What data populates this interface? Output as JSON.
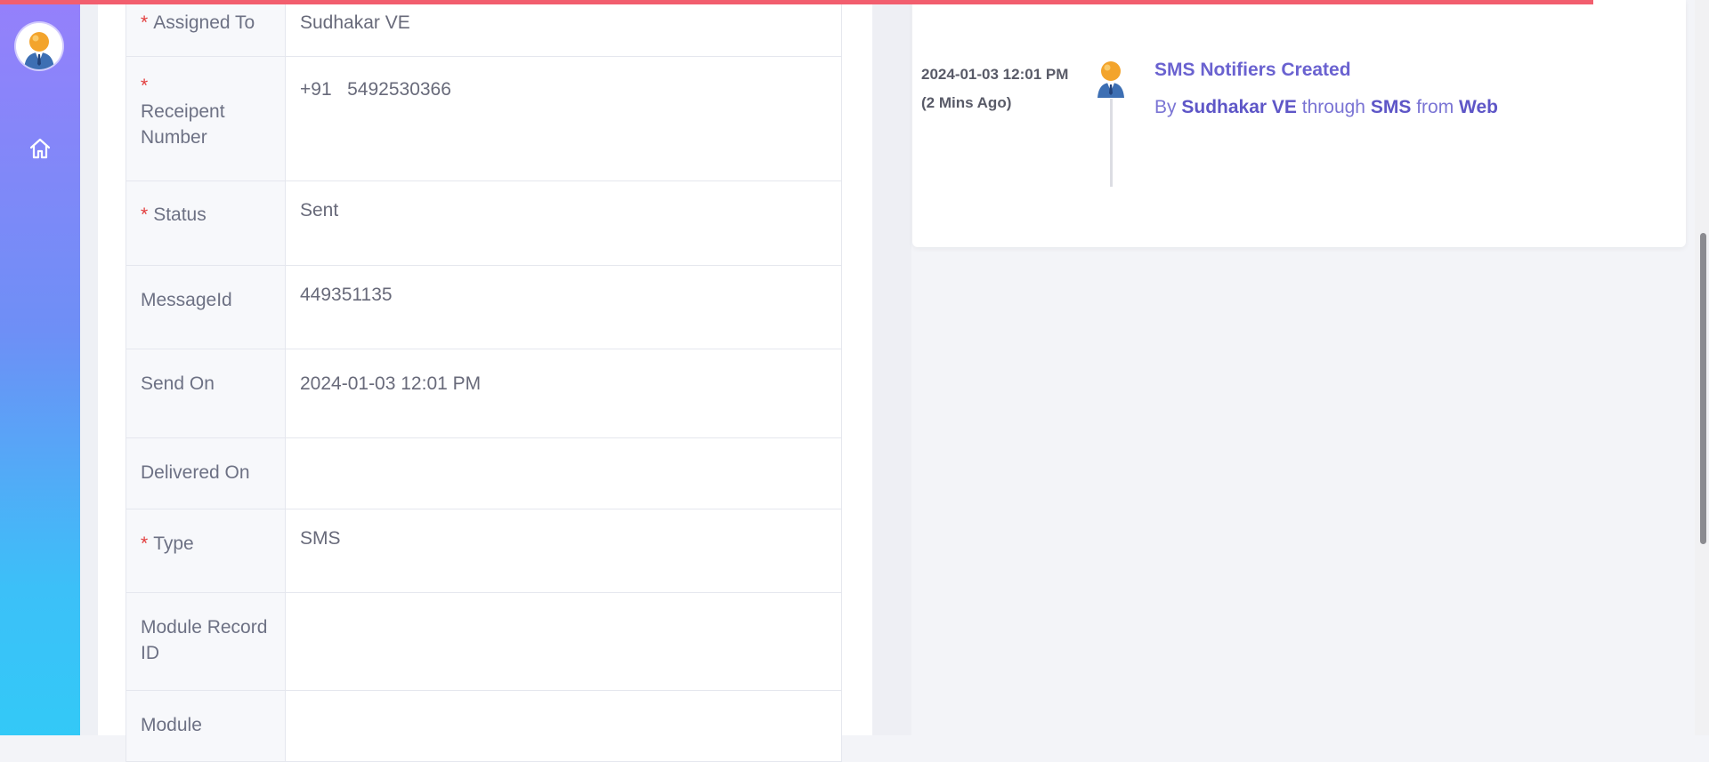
{
  "colors": {
    "accent": "#6a62d0",
    "required": "#e23d3d",
    "top_bar": "#f25e6e"
  },
  "sidebar": {
    "icons": [
      "user-avatar",
      "home-icon"
    ]
  },
  "fields": [
    {
      "label": "Assigned To",
      "required": true,
      "value": "Sudhakar VE"
    },
    {
      "label": "Receipent Number",
      "required": true,
      "value": "+91   5492530366"
    },
    {
      "label": "Status",
      "required": true,
      "value": "Sent"
    },
    {
      "label": "MessageId",
      "required": false,
      "value": "449351135"
    },
    {
      "label": "Send On",
      "required": false,
      "value": "2024-01-03 12:01 PM"
    },
    {
      "label": "Delivered On",
      "required": false,
      "value": ""
    },
    {
      "label": "Type",
      "required": true,
      "value": "SMS"
    },
    {
      "label": "Module Record ID",
      "required": false,
      "value": ""
    },
    {
      "label": "Module",
      "required": false,
      "value": ""
    }
  ],
  "timeline": {
    "timestamp": "2024-01-03 12:01 PM",
    "relative": "(2 Mins Ago)",
    "title": "SMS Notifiers Created",
    "by_prefix": "By",
    "user": "Sudhakar VE",
    "through_word": "through",
    "channel": "SMS",
    "from_word": "from",
    "source": "Web"
  }
}
